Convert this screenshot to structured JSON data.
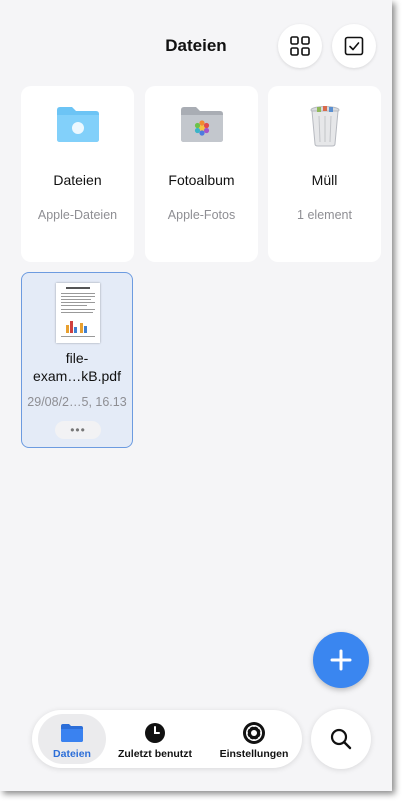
{
  "header": {
    "title": "Dateien"
  },
  "toolbar": {
    "grid_icon": "grid-icon",
    "select_icon": "checkbox-icon"
  },
  "locations": [
    {
      "name": "Dateien",
      "subtitle": "Apple-Dateien",
      "icon": "folder-icon",
      "color": "#6cc4f5"
    },
    {
      "name": "Fotoalbum",
      "subtitle": "Apple-Fotos",
      "icon": "photo-folder-icon",
      "color": "#b8bcc3"
    },
    {
      "name": "Müll",
      "subtitle": "1 element",
      "icon": "trash-icon",
      "color": "#c9ccd1"
    }
  ],
  "files": [
    {
      "name": "file-exam…kB.pdf",
      "date": "29/08/2…5, 16.13",
      "more": "•••"
    }
  ],
  "fab": {
    "icon": "plus-icon",
    "color": "#3a86f0"
  },
  "tabbar": {
    "tabs": [
      {
        "label": "Dateien",
        "icon": "folder-icon",
        "active": true
      },
      {
        "label": "Zuletzt benutzt",
        "icon": "clock-icon",
        "active": false
      },
      {
        "label": "Einstellungen",
        "icon": "gear-icon",
        "active": false
      }
    ],
    "search_icon": "search-icon"
  },
  "colors": {
    "accent": "#2c6ed8",
    "selection_bg": "#e4ebf7",
    "selection_border": "#6c9be0"
  }
}
